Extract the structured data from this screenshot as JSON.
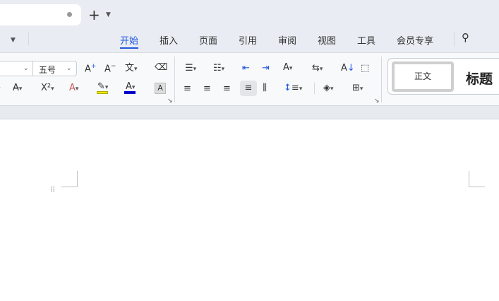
{
  "tabbar": {
    "new_tab": "+",
    "menu": "⌄"
  },
  "ribbon_tabs": [
    {
      "label": "开始",
      "active": true
    },
    {
      "label": "插入"
    },
    {
      "label": "页面"
    },
    {
      "label": "引用"
    },
    {
      "label": "审阅"
    },
    {
      "label": "视图"
    },
    {
      "label": "工具"
    },
    {
      "label": "会员专享"
    }
  ],
  "font": {
    "name": "",
    "size": "五号"
  },
  "styles": {
    "normal": "正文",
    "heading": "标题"
  },
  "colors": {
    "accent": "#2257e0",
    "highlight": "#f5e900",
    "font_color": "#0000cc"
  }
}
